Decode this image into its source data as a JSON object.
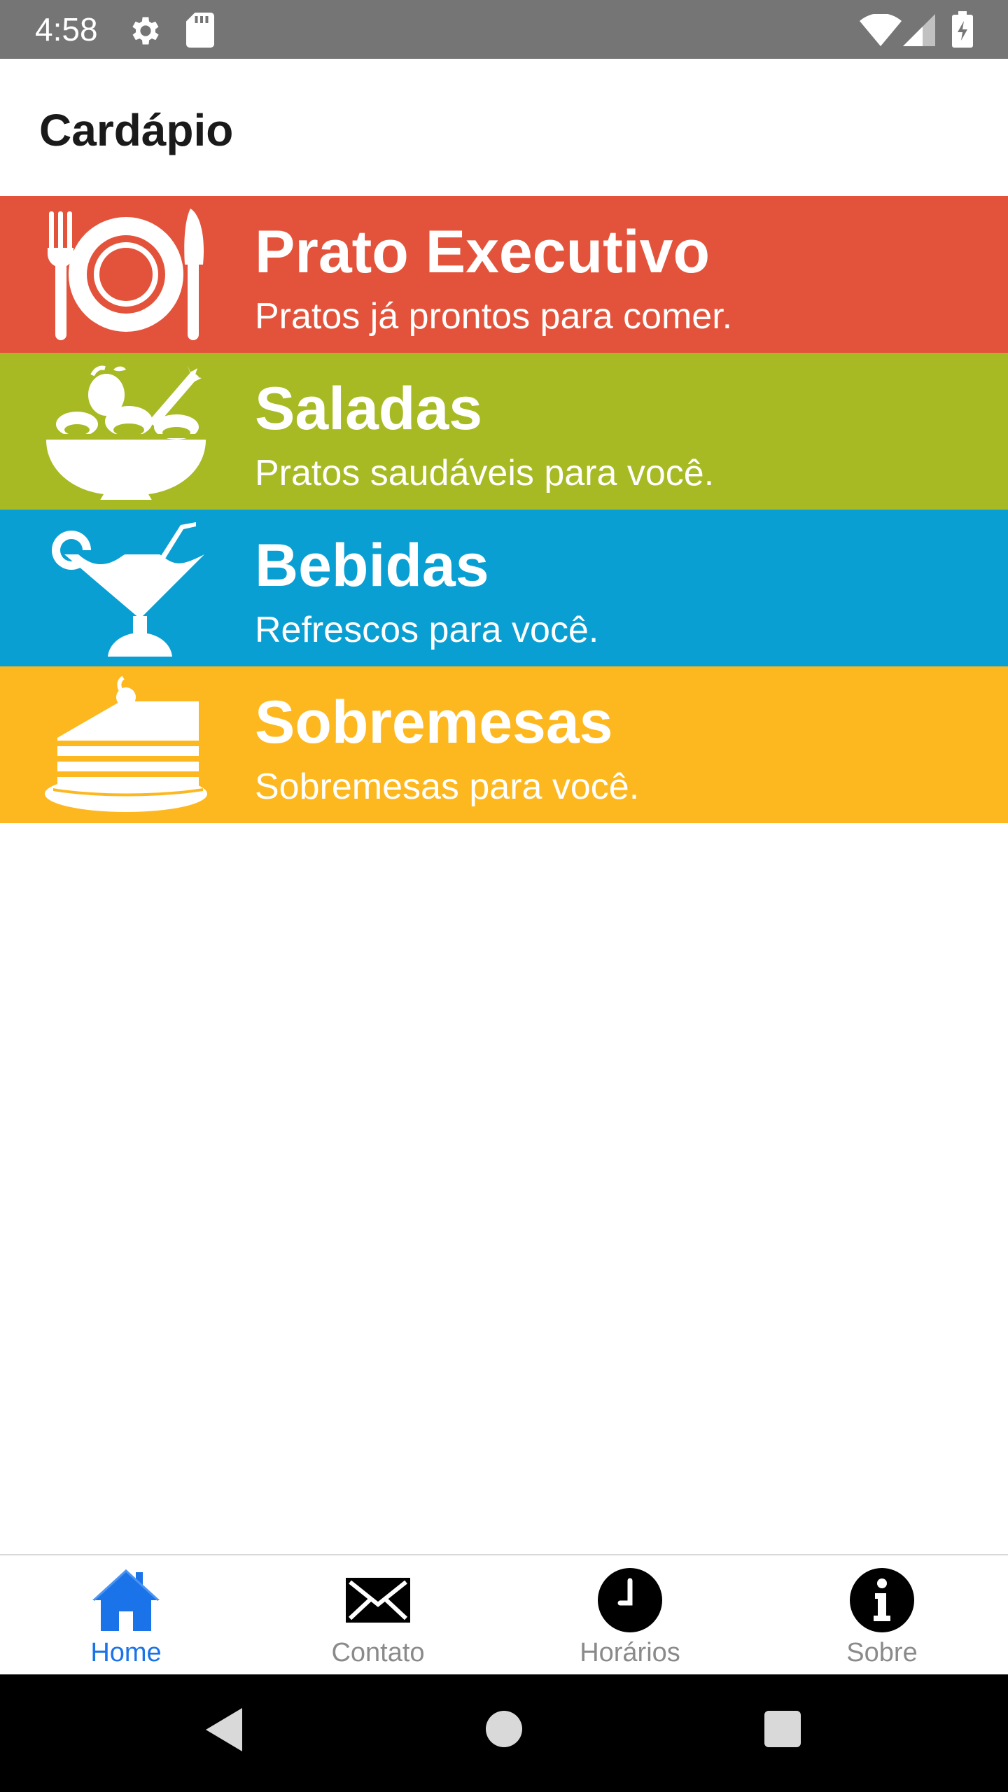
{
  "status_bar": {
    "time": "4:58",
    "icons": [
      "gear-icon",
      "sd-card-icon",
      "wifi-icon",
      "signal-icon",
      "battery-icon"
    ]
  },
  "app_bar": {
    "title": "Cardápio"
  },
  "menu": {
    "items": [
      {
        "title": "Prato Executivo",
        "subtitle": "Pratos já prontos para comer.",
        "color": "#E3533B",
        "icon": "plate-cutlery-icon"
      },
      {
        "title": "Saladas",
        "subtitle": "Pratos saudáveis para você.",
        "color": "#A7BA24",
        "icon": "salad-bowl-icon"
      },
      {
        "title": "Bebidas",
        "subtitle": "Refrescos para você.",
        "color": "#099FD3",
        "icon": "cocktail-icon"
      },
      {
        "title": "Sobremesas",
        "subtitle": "Sobremesas para você.",
        "color": "#FDB820",
        "icon": "cake-slice-icon"
      }
    ]
  },
  "bottom_nav": {
    "active_color": "#1a73e8",
    "inactive_color": "#8a8a8a",
    "items": [
      {
        "label": "Home",
        "icon": "home-icon",
        "active": true
      },
      {
        "label": "Contato",
        "icon": "envelope-icon",
        "active": false
      },
      {
        "label": "Horários",
        "icon": "clock-icon",
        "active": false
      },
      {
        "label": "Sobre",
        "icon": "info-icon",
        "active": false
      }
    ]
  },
  "system_nav": {
    "buttons": [
      "back-icon",
      "home-circle-icon",
      "recents-icon"
    ]
  }
}
